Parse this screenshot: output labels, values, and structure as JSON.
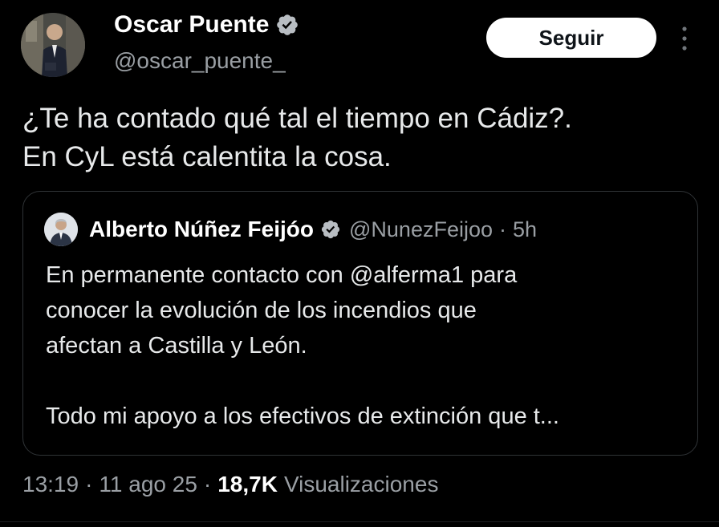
{
  "author": {
    "display_name": "Oscar Puente",
    "handle": "@oscar_puente_",
    "avatar": "person-in-suit-avatar",
    "verified_icon": "verified-badge-icon"
  },
  "actions": {
    "follow_label": "Seguir",
    "more_icon": "more-vertical-icon"
  },
  "tweet": {
    "lines": [
      "¿Te ha contado qué tal el tiempo en Cádiz?.",
      "En CyL está calentita la cosa."
    ]
  },
  "quoted": {
    "display_name": "Alberto Núñez Feijóo",
    "handle": "@NunezFeijoo",
    "dot": "·",
    "time": "5h",
    "avatar": "person-avatar",
    "verified_icon": "verified-badge-icon",
    "lines": [
      "En permanente contacto con @alferma1 para",
      "conocer la evolución de los incendios que",
      "afectan a Castilla y León.",
      "Todo mi apoyo a los efectivos de extinción que t..."
    ]
  },
  "meta": {
    "time": "13:19",
    "sep": "·",
    "date": "11 ago 25",
    "views_count": "18,7K",
    "views_label": "Visualizaciones"
  },
  "colors": {
    "background": "#000000",
    "text_primary": "#e7e9ea",
    "text_secondary": "#9a9fa4",
    "border": "#2f3336",
    "button_bg": "#ffffff",
    "button_text": "#0f1419",
    "verified_badge": "#b8bdc2"
  }
}
